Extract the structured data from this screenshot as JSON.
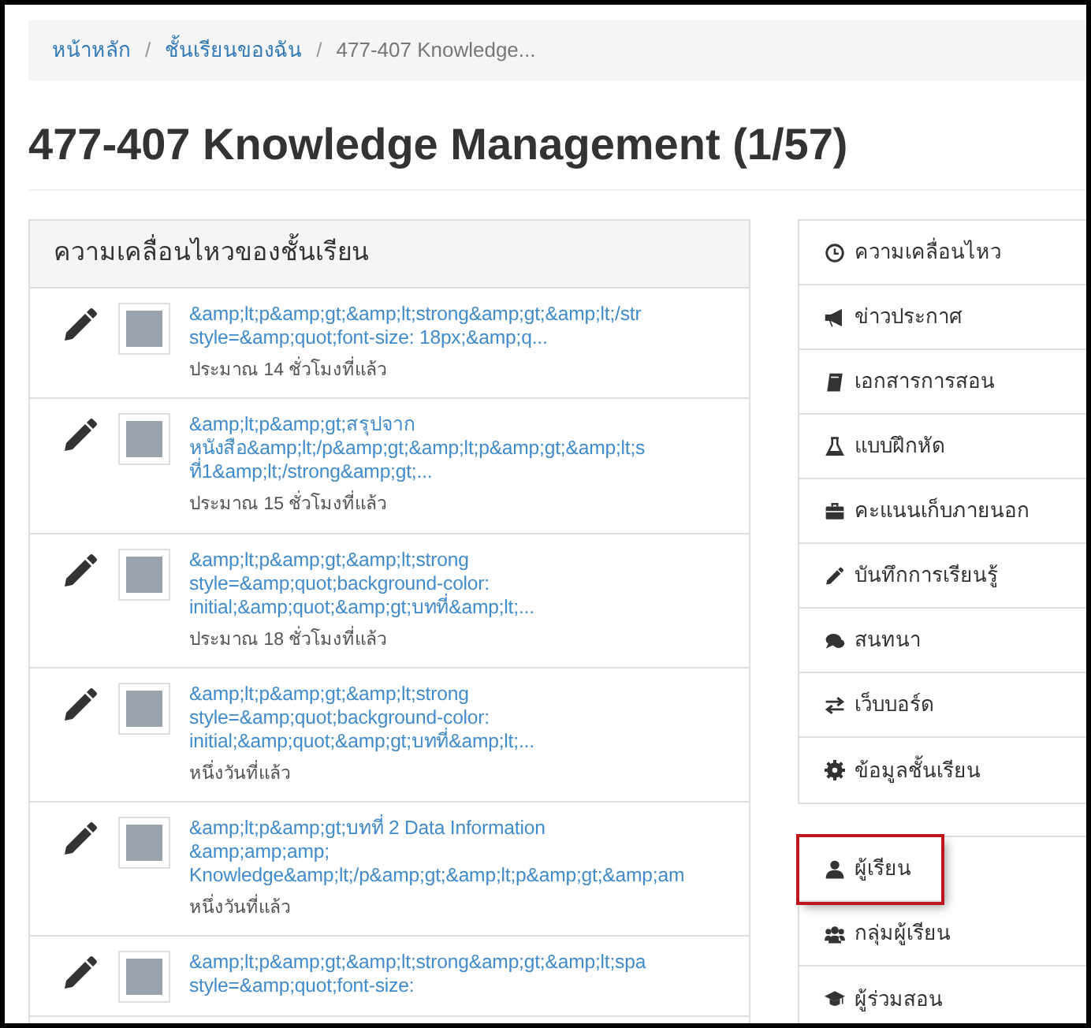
{
  "breadcrumb": [
    {
      "kind": "link",
      "label": "หน้าหลัก"
    },
    {
      "kind": "separator",
      "label": "/"
    },
    {
      "kind": "link",
      "label": "ชั้นเรียนของฉัน"
    },
    {
      "kind": "separator",
      "label": "/"
    },
    {
      "kind": "current",
      "label": "477-407 Knowledge..."
    }
  ],
  "page_title": "477-407 Knowledge Management (1/57)",
  "activity": {
    "title": "ความเคลื่อนไหวของชั้นเรียน",
    "items": [
      {
        "lines": [
          "&amp;lt;p&amp;gt;&amp;lt;strong&amp;gt;&amp;lt;/str",
          "style=&amp;quot;font-size: 18px;&amp;q..."
        ],
        "time": "ประมาณ 14 ชั่วโมงที่แล้ว"
      },
      {
        "lines": [
          "&amp;lt;p&amp;gt;สรุปจาก",
          "หนังสือ&amp;lt;/p&amp;gt;&amp;lt;p&amp;gt;&amp;lt;s",
          "ที่1&amp;lt;/strong&amp;gt;..."
        ],
        "time": "ประมาณ 15 ชั่วโมงที่แล้ว"
      },
      {
        "lines": [
          "&amp;lt;p&amp;gt;&amp;lt;strong",
          "style=&amp;quot;background-color:",
          "initial;&amp;quot;&amp;gt;บทที่&amp;lt;..."
        ],
        "time": "ประมาณ 18 ชั่วโมงที่แล้ว"
      },
      {
        "lines": [
          "&amp;lt;p&amp;gt;&amp;lt;strong",
          "style=&amp;quot;background-color:",
          "initial;&amp;quot;&amp;gt;บทที่&amp;lt;..."
        ],
        "time": "หนึ่งวันที่แล้ว"
      },
      {
        "lines": [
          "&amp;lt;p&amp;gt;บทที่ 2 Data Information",
          "&amp;amp;amp;",
          "Knowledge&amp;lt;/p&amp;gt;&amp;lt;p&amp;gt;&amp;am"
        ],
        "time": "หนึ่งวันที่แล้ว"
      },
      {
        "lines": [
          "&amp;lt;p&amp;gt;&amp;lt;strong&amp;gt;&amp;lt;spa",
          "style=&amp;quot;font-size:"
        ]
      }
    ]
  },
  "nav_groups": [
    [
      {
        "kind": "clock",
        "label": "ความเคลื่อนไหว",
        "highlighted": false
      },
      {
        "kind": "bullhorn",
        "label": "ข่าวประกาศ",
        "highlighted": false
      },
      {
        "kind": "book",
        "label": "เอกสารการสอน",
        "highlighted": false
      },
      {
        "kind": "flask",
        "label": "แบบฝึกหัด",
        "highlighted": false
      },
      {
        "kind": "briefcase",
        "label": "คะแนนเก็บภายนอก",
        "highlighted": false
      },
      {
        "kind": "pencil",
        "label": "บันทึกการเรียนรู้",
        "highlighted": false
      },
      {
        "kind": "comments",
        "label": "สนทนา",
        "highlighted": false
      },
      {
        "kind": "exchange",
        "label": "เว็บบอร์ด",
        "highlighted": false
      },
      {
        "kind": "gear",
        "label": "ข้อมูลชั้นเรียน",
        "highlighted": false
      }
    ],
    [
      {
        "kind": "user",
        "label": "ผู้เรียน",
        "highlighted": true
      },
      {
        "kind": "users",
        "label": "กลุ่มผู้เรียน",
        "highlighted": false
      },
      {
        "kind": "cap",
        "label": "ผู้ร่วมสอน",
        "highlighted": false
      }
    ]
  ]
}
